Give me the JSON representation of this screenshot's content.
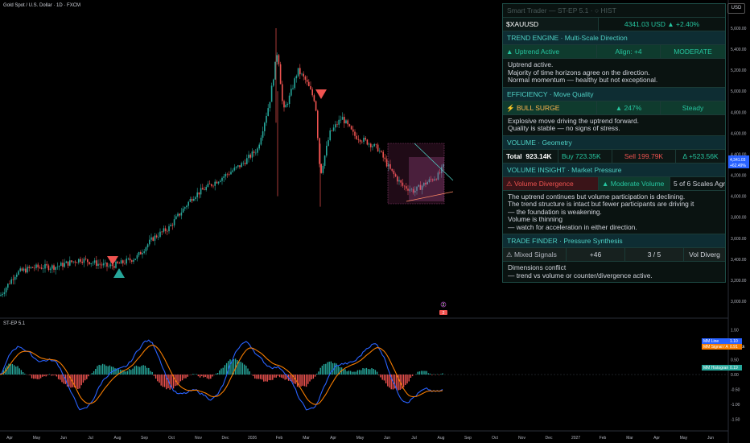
{
  "header": {
    "title": "Gold Spot / U.S. Dollar · 1D · FXCM"
  },
  "osc_label": "ST-EP 5.1",
  "currency": "USD",
  "price_axis": [
    "5,600.00",
    "5,400.00",
    "5,200.00",
    "5,000.00",
    "4,800.00",
    "4,600.00",
    "4,400.00",
    "4,200.00",
    "4,000.00",
    "3,800.00",
    "3,600.00",
    "3,400.00",
    "3,200.00",
    "3,000.00"
  ],
  "price_tag": {
    "price": "4,341.03",
    "change": "+62.49%"
  },
  "osc_axis": [
    "1.50",
    "1.00",
    "0.50",
    "0.00",
    "-0.50",
    "-1.00",
    "-1.50"
  ],
  "osc_tags": [
    {
      "label": "MM Line",
      "value": "1.10",
      "color": "#2962ff"
    },
    {
      "label": "MM Signal / Avg Shock",
      "value": "0.91",
      "color": "#f57c00"
    },
    {
      "label": "MM Histogram",
      "value": "0.19",
      "color": "#26a69a"
    }
  ],
  "time_axis": [
    "Apr",
    "May",
    "Jun",
    "Jul",
    "Aug",
    "Sep",
    "Oct",
    "Nov",
    "Dec",
    "2026",
    "Feb",
    "Mar",
    "Apr",
    "May",
    "Jun",
    "Jul",
    "Aug",
    "Sep",
    "Oct",
    "Nov",
    "Dec",
    "2027",
    "Feb",
    "Mar",
    "Apr",
    "May",
    "Jun"
  ],
  "markers": {
    "badge_top": "2",
    "badge_bottom": "2"
  },
  "panel": {
    "title": "Smart Trader — ST-EP 5.1  ·  ○ HIST",
    "symbol": "$XAUUSD",
    "price_line": "4341.03 USD ▲ +2.40%",
    "trend_header": "TREND ENGINE  ·  Multi-Scale Direction",
    "trend_state": "▲ Uptrend Active",
    "trend_align": "Align: +4",
    "trend_strength": "MODERATE",
    "trend_text": [
      "Uptrend active.",
      "Majority of time horizons agree on the direction.",
      "Normal momentum — healthy but not exceptional."
    ],
    "eff_header": "EFFICIENCY  ·  Move Quality",
    "eff_state": "⚡ BULL SURGE",
    "eff_pct": "▲ 247%",
    "eff_quality": "Steady",
    "eff_text": [
      "Explosive move driving the uptrend forward.",
      "Quality is stable — no signs of stress."
    ],
    "vol_header": "VOLUME  ·  Geometry",
    "vol_total_label": "Total",
    "vol_total": "923.14K",
    "vol_buy": "Buy  723.35K",
    "vol_sell": "Sell  199.79K",
    "vol_delta": "Δ  +523.56K",
    "vi_header": "VOLUME INSIGHT  ·  Market Pressure",
    "vi_state": "⚠ Volume Divergence",
    "vi_level": "▲ Moderate Volume",
    "vi_scales": "5 of 6 Scales Agree",
    "vi_text": [
      "The uptrend continues but volume participation is declining.",
      "The trend structure is intact but fewer participants are driving it",
      "— the foundation is weakening.",
      "Volume is thinning",
      "— watch for acceleration in either direction."
    ],
    "tf_header": "TRADE FINDER  ·  Pressure Synthesis",
    "tf_state": "⚠ Mixed Signals",
    "tf_score": "+46",
    "tf_ratio": "3 / 5",
    "tf_reason": "Vol Diverg",
    "tf_text": [
      "Dimensions conflict",
      "— trend vs volume or counter/divergence active."
    ]
  },
  "colors": {
    "up": "#26a69a",
    "down": "#ef5350",
    "accent": "#4fd1c5",
    "macd": "#2962ff",
    "signal": "#f57c00"
  }
}
